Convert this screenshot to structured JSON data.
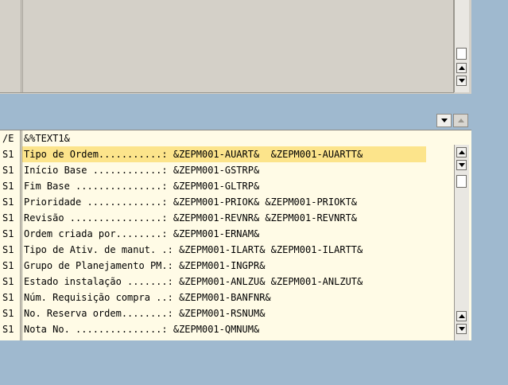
{
  "editor": {
    "lines": [
      {
        "format": "/E",
        "text": "&%TEXT1&"
      },
      {
        "format": "S1",
        "text": "Tipo de Ordem...........: &ZEPM001-AUART&  &ZEPM001-AUARTT&",
        "highlighted": true
      },
      {
        "format": "S1",
        "text": "Início Base ............: &ZEPM001-GSTRP&"
      },
      {
        "format": "S1",
        "text": "Fim Base ...............: &ZEPM001-GLTRP&"
      },
      {
        "format": "S1",
        "text": "Prioridade .............: &ZEPM001-PRIOK& &ZEPM001-PRIOKT&"
      },
      {
        "format": "S1",
        "text": "Revisão ................: &ZEPM001-REVNR& &ZEPM001-REVNRT&"
      },
      {
        "format": "S1",
        "text": "Ordem criada por........: &ZEPM001-ERNAM&"
      },
      {
        "format": "S1",
        "text": "Tipo de Ativ. de manut. .: &ZEPM001-ILART& &ZEPM001-ILARTT&"
      },
      {
        "format": "S1",
        "text": "Grupo de Planejamento PM.: &ZEPM001-INGPR&"
      },
      {
        "format": "S1",
        "text": "Estado instalação .......: &ZEPM001-ANLZU& &ZEPM001-ANLZUT&"
      },
      {
        "format": "S1",
        "text": "Núm. Requisição compra ..: &ZEPM001-BANFNR&"
      },
      {
        "format": "S1",
        "text": "No. Reserva ordem........: &ZEPM001-RSNUM&"
      },
      {
        "format": "S1",
        "text": "Nota No. ...............: &ZEPM001-QMNUM&"
      }
    ]
  },
  "icons": {
    "scroll_up": "triangle-up-icon",
    "scroll_down": "triangle-down-icon"
  },
  "colors": {
    "background": "#9fb9cf",
    "editor_bg": "#fffbe6",
    "highlight": "#fce48b",
    "pane_gray": "#d4d0c8"
  }
}
